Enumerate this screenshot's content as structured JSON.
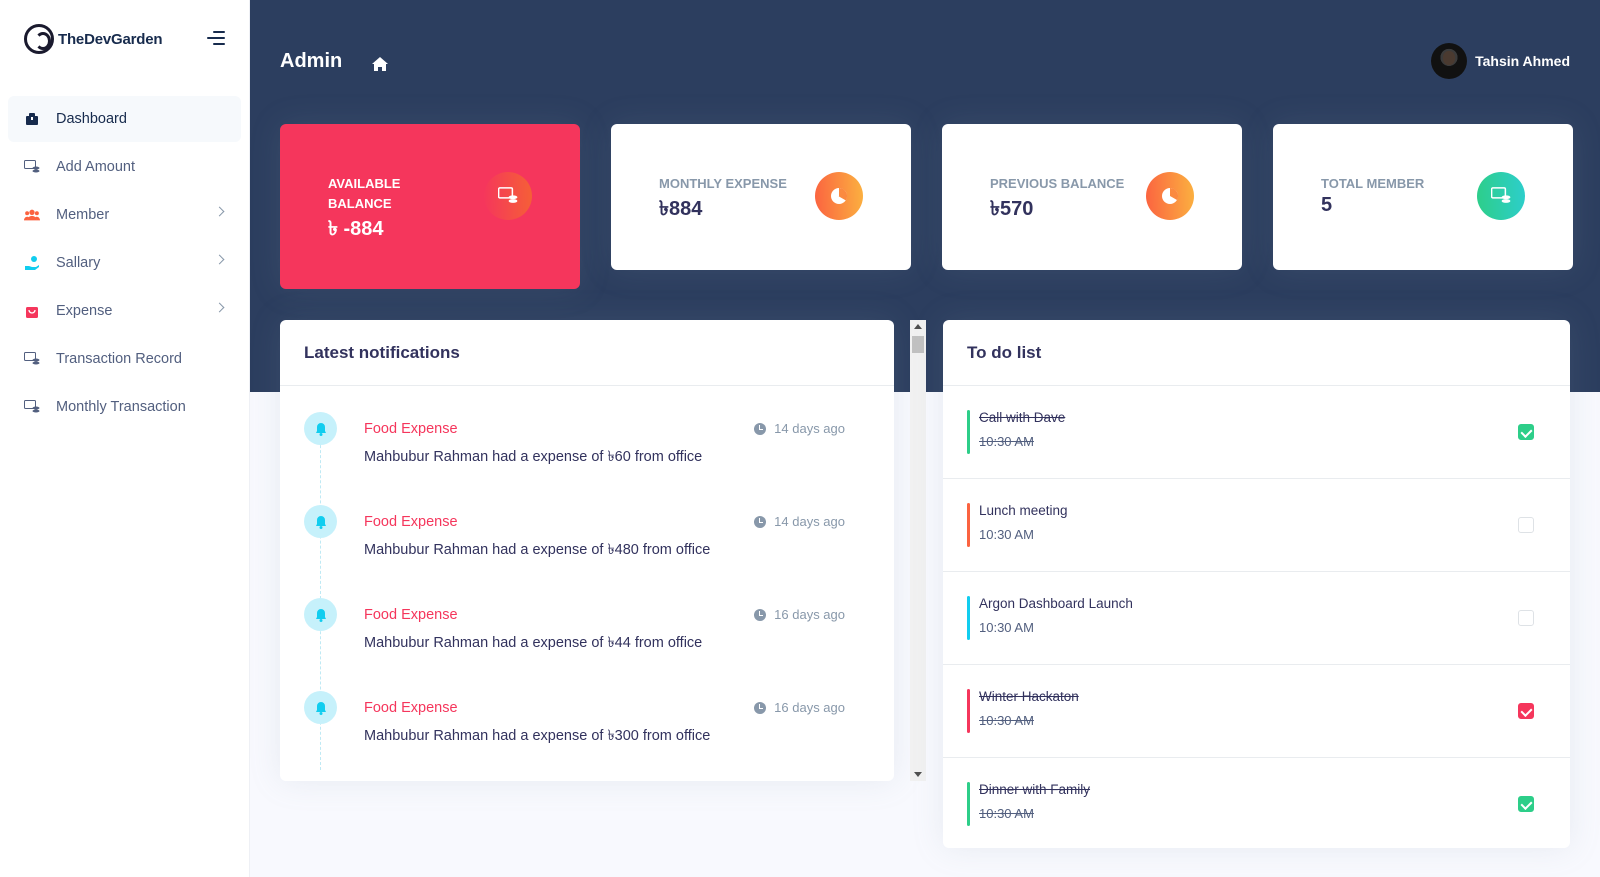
{
  "brand": {
    "name": "TheDevGarden"
  },
  "sidebar": {
    "items": [
      {
        "label": "Dashboard",
        "icon": "dashboard-icon",
        "active": true,
        "has_submenu": false
      },
      {
        "label": "Add Amount",
        "icon": "money-stack-icon",
        "has_submenu": false
      },
      {
        "label": "Member",
        "icon": "users-icon",
        "has_submenu": true
      },
      {
        "label": "Sallary",
        "icon": "hand-coin-icon",
        "has_submenu": true
      },
      {
        "label": "Expense",
        "icon": "shopping-bag-icon",
        "has_submenu": true
      },
      {
        "label": "Transaction Record",
        "icon": "money-stack-icon",
        "has_submenu": false
      },
      {
        "label": "Monthly Transaction",
        "icon": "money-stack-icon",
        "has_submenu": false
      }
    ]
  },
  "header": {
    "title": "Admin",
    "user_name": "Tahsin Ahmed"
  },
  "stats": [
    {
      "label": "AVAILABLE BALANCE",
      "value": "৳ -884",
      "icon": "money-stack-icon",
      "color": "#f5365c"
    },
    {
      "label": "MONTHLY EXPENSE",
      "value": "৳884",
      "icon": "pie-chart-icon",
      "color": "#fb6340"
    },
    {
      "label": "PREVIOUS BALANCE",
      "value": "৳570",
      "icon": "pie-chart-icon",
      "color": "#fb6340"
    },
    {
      "label": "TOTAL MEMBER",
      "value": "5",
      "icon": "money-stack-icon",
      "color": "#2dce89"
    }
  ],
  "notifications": {
    "title": "Latest notifications",
    "items": [
      {
        "title": "Food Expense",
        "text": "Mahbubur Rahman had a expense of ৳60 from office",
        "time": "14 days ago"
      },
      {
        "title": "Food Expense",
        "text": "Mahbubur Rahman had a expense of ৳480 from office",
        "time": "14 days ago"
      },
      {
        "title": "Food Expense",
        "text": "Mahbubur Rahman had a expense of ৳44 from office",
        "time": "16 days ago"
      },
      {
        "title": "Food Expense",
        "text": "Mahbubur Rahman had a expense of ৳300 from office",
        "time": "16 days ago"
      }
    ]
  },
  "todo": {
    "title": "To do list",
    "items": [
      {
        "title": "Call with Dave",
        "time": "10:30 AM",
        "done": true,
        "color": "#2dce89"
      },
      {
        "title": "Lunch meeting",
        "time": "10:30 AM",
        "done": false,
        "color": "#fb6340"
      },
      {
        "title": "Argon Dashboard Launch",
        "time": "10:30 AM",
        "done": false,
        "color": "#11cdef"
      },
      {
        "title": "Winter Hackaton",
        "time": "10:30 AM",
        "done": true,
        "color": "#f5365c"
      },
      {
        "title": "Dinner with Family",
        "time": "10:30 AM",
        "done": true,
        "color": "#2dce89"
      }
    ]
  }
}
